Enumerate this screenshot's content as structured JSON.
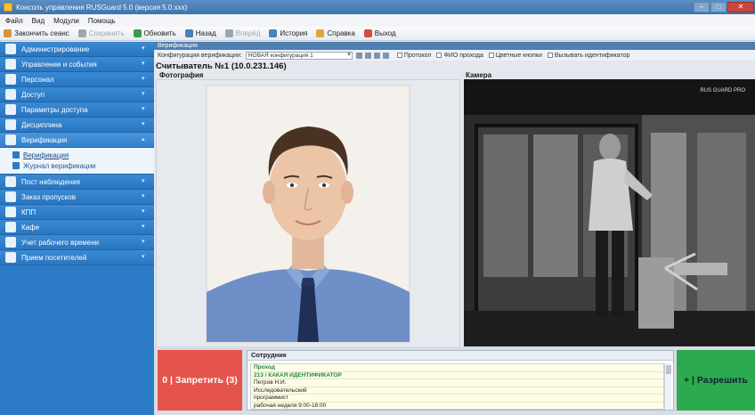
{
  "window": {
    "title": "Консоль управления RUSGuard 5.0 (версия 5.0.xxx)"
  },
  "menu": [
    "Файл",
    "Вид",
    "Модули",
    "Помощь"
  ],
  "toolbar": {
    "items": [
      {
        "label": "Закончить сеанс",
        "icon": "logout-icon",
        "color": "#d9923a",
        "enabled": true
      },
      {
        "label": "Сохранить",
        "icon": "save-icon",
        "color": "#9aa6b4",
        "enabled": false
      },
      {
        "label": "Обновить",
        "icon": "refresh-icon",
        "color": "#3c9b4a",
        "enabled": true
      },
      {
        "label": "Назад",
        "icon": "back-icon",
        "color": "#4a7fb8",
        "enabled": true
      },
      {
        "label": "Вперёд",
        "icon": "forward-icon",
        "color": "#9aa6b4",
        "enabled": false
      },
      {
        "label": "История",
        "icon": "history-icon",
        "color": "#4a7fb8",
        "enabled": true
      },
      {
        "label": "Справка",
        "icon": "help-icon",
        "color": "#e0a53a",
        "enabled": true
      },
      {
        "label": "Выход",
        "icon": "exit-icon",
        "color": "#d24b3d",
        "enabled": true
      }
    ]
  },
  "sidebar": {
    "groups": [
      {
        "label": "Администрирование",
        "icon": "gear-icon"
      },
      {
        "label": "Управление и события",
        "icon": "monitor-icon"
      },
      {
        "label": "Персонал",
        "icon": "person-icon"
      },
      {
        "label": "Доступ",
        "icon": "key-icon"
      },
      {
        "label": "Параметры доступа",
        "icon": "settings-icon"
      },
      {
        "label": "Дисциплина",
        "icon": "clock-icon"
      },
      {
        "label": "Верификация",
        "icon": "verify-icon",
        "expanded": true,
        "items": [
          {
            "label": "Верификация",
            "active": true
          },
          {
            "label": "Журнал верификации",
            "active": false
          }
        ]
      },
      {
        "label": "Пост наблюдения",
        "icon": "watch-icon"
      },
      {
        "label": "Заказ пропусков",
        "icon": "card-icon"
      },
      {
        "label": "КПП",
        "icon": "truck-icon"
      },
      {
        "label": "Кафе",
        "icon": "cup-icon"
      },
      {
        "label": "Учет рабочего времени",
        "icon": "clock-icon"
      },
      {
        "label": "Прием посетителей",
        "icon": "visitors-icon"
      }
    ]
  },
  "content": {
    "title": "Верификация",
    "config_label": "Конфигурация верификации:",
    "config_value": "НОВАЯ конфигурация 1",
    "checkboxes": [
      "Протокол",
      "ФИО прохода",
      "Цветные кнопки",
      "Вызывать идентификатор"
    ],
    "reader_title": "Считыватель №1 (10.0.231.146)",
    "photo_label": "Фотография",
    "camera_label": "Камера",
    "camera_overlay": "RUS GUARD PRO"
  },
  "actions": {
    "deny_label": "0 | Запретить (3)",
    "allow_label": "+ | Разрешить"
  },
  "employee": {
    "header": "Сотрудник",
    "rows": [
      {
        "text": "Проход",
        "pass": true
      },
      {
        "text": "213 / КАКАЯ ИДЕНТИФИКАТОР",
        "pass": true
      },
      {
        "text": "Петров Н.И.",
        "pass": false
      },
      {
        "text": "Исследовательский",
        "pass": false
      },
      {
        "text": "программист",
        "pass": false
      },
      {
        "text": "рабочая неделя 9:00-18:00",
        "pass": false
      }
    ]
  }
}
